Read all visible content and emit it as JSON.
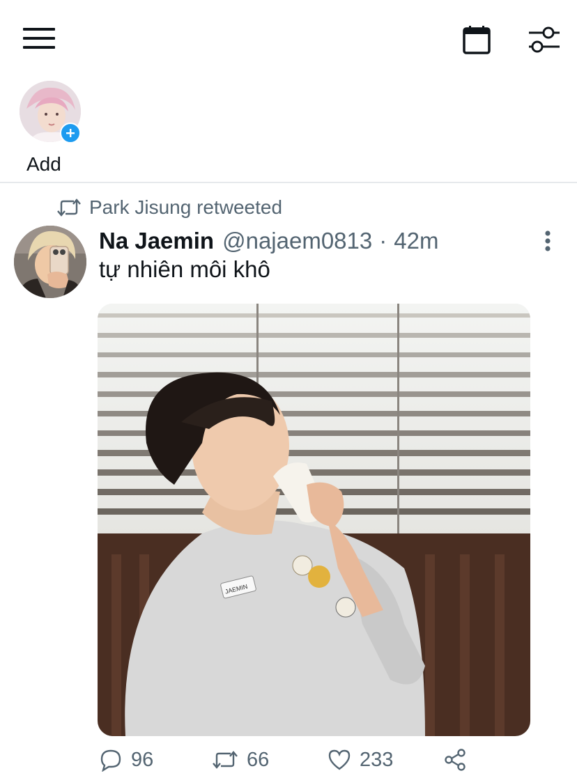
{
  "header": {
    "menu_icon": "hamburger-menu-icon",
    "calendar_icon": "calendar-icon",
    "filter_icon": "sliders-filter-icon"
  },
  "fleets": {
    "add_label": "Add"
  },
  "tweet": {
    "retweeted_by": "Park Jisung retweeted",
    "author_name": "Na Jaemin",
    "author_handle": "@najaem0813",
    "separator": "·",
    "time_ago": "42m",
    "text": "tự nhiên môi khô",
    "media_badge": "JAEMIN",
    "counts": {
      "replies": "96",
      "retweets": "66",
      "likes": "233"
    }
  },
  "colors": {
    "accent": "#1d9bf0",
    "text_primary": "#0f1419",
    "text_secondary": "#536471",
    "divider": "#e6e9ec"
  }
}
